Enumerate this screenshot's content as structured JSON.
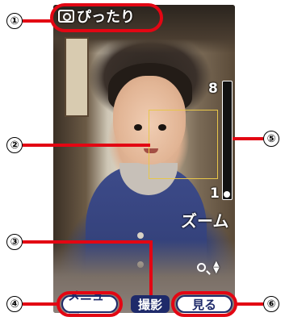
{
  "camera": {
    "mode_label": "ぴったり",
    "mode_icon": "camera-icon"
  },
  "zoom": {
    "max_label": "8",
    "min_label": "1",
    "label": "ズーム",
    "level_fraction": 0.0,
    "icon": "zoom-in-icon",
    "updown_symbol": "▲\n▼"
  },
  "softkeys": {
    "left": "メニュー",
    "center": "撮影",
    "right": "見る"
  },
  "callouts": [
    "①",
    "②",
    "③",
    "④",
    "⑤",
    "⑥"
  ],
  "colors": {
    "callout_line": "#e30613",
    "face_frame": "#e7c64a",
    "softkey_text": "#1e2a6a"
  }
}
